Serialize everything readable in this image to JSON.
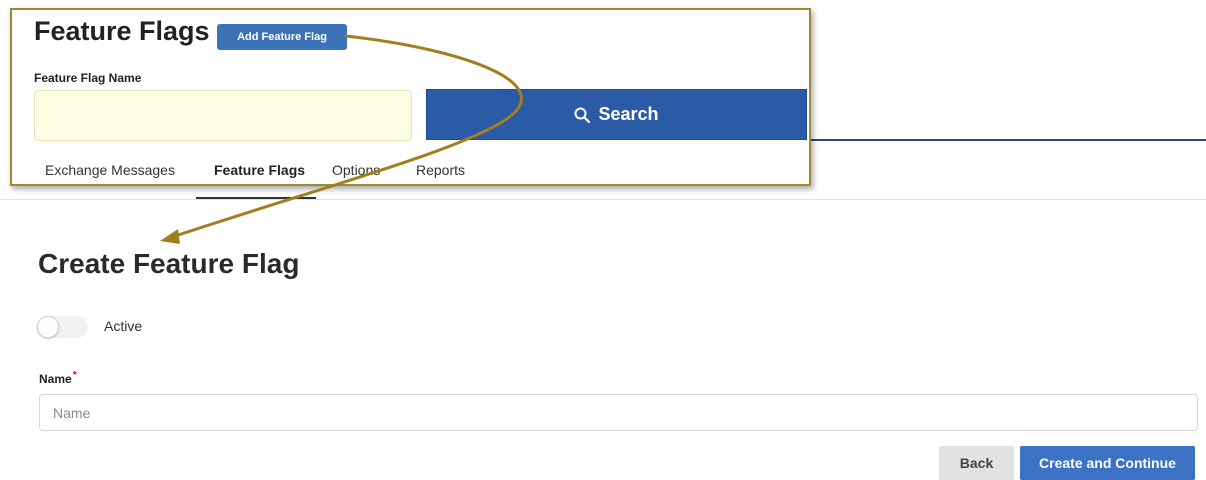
{
  "callout": {
    "title": "Feature Flags",
    "add_button_label": "Add Feature Flag",
    "flag_name_label": "Feature Flag Name",
    "flag_name_value": "",
    "search_button_label": "Search",
    "search_icon": "magnifier-icon",
    "tabs": [
      {
        "label": "Exchange Messages",
        "active": false
      },
      {
        "label": "Feature Flags",
        "active": true
      },
      {
        "label": "Options",
        "active": false
      },
      {
        "label": "Reports",
        "active": false
      }
    ]
  },
  "page": {
    "title": "Create Feature Flag",
    "active_toggle": {
      "label": "Active",
      "on": false
    },
    "name_field": {
      "label": "Name",
      "required_mark": "*",
      "placeholder": "Name",
      "value": ""
    },
    "back_button_label": "Back",
    "create_button_label": "Create and Continue"
  },
  "colors": {
    "callout_border": "#a08a2e",
    "arrow": "#a07f1e",
    "primary_button": "#3c72c4",
    "search_button": "#2b5aa6",
    "input_highlight": "#fdfde3",
    "required": "#d0021b"
  }
}
